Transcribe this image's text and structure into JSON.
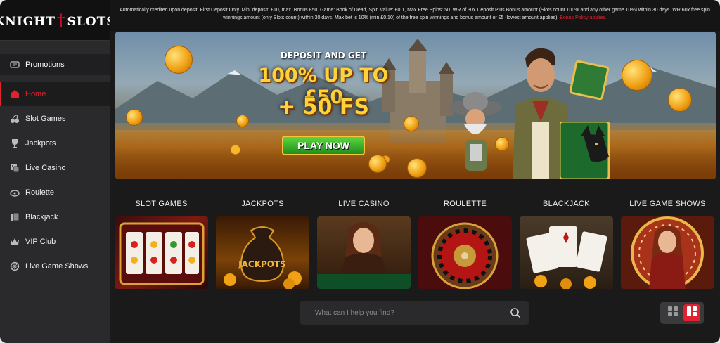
{
  "logo": {
    "left": "KNIGHT",
    "right": "SLOTS"
  },
  "notice": {
    "text": "Automatically credited upon deposit. First Deposit Only. Min. deposit: £10, max. Bonus £50. Game: Book of Dead, Spin Value: £0.1, Max Free Spins: 50. WR of 30x Deposit Plus Bonus amount (Slots count 100% and any other game 10%) within 30 days. WR 60x free spin winnings amount (only Slots count) within 30 days. Max bet is 10% (min £0.10) of the free spin winnings and bonus amount or £5 (lowest amount applies).",
    "policy_link": "Bonus Policy applies."
  },
  "sidebar": {
    "promo": {
      "label": "Promotions",
      "icon": "ticket-icon"
    },
    "items": [
      {
        "label": "Home",
        "icon": "home-icon",
        "active": true
      },
      {
        "label": "Slot Games",
        "icon": "cherries-icon"
      },
      {
        "label": "Jackpots",
        "icon": "trophy-icon"
      },
      {
        "label": "Live Casino",
        "icon": "dice-icon"
      },
      {
        "label": "Roulette",
        "icon": "roulette-icon"
      },
      {
        "label": "Blackjack",
        "icon": "cards-icon"
      },
      {
        "label": "VIP Club",
        "icon": "crown-icon"
      },
      {
        "label": "Live Game Shows",
        "icon": "wheel-icon"
      }
    ]
  },
  "banner": {
    "line1": "DEPOSIT AND GET",
    "line2": "100% UP TO £50",
    "line3": "+ 50 FS",
    "cta": "PLAY NOW"
  },
  "categories": [
    {
      "label": "SLOT GAMES"
    },
    {
      "label": "JACKPOTS",
      "image_text": "JACKPOTS"
    },
    {
      "label": "LIVE CASINO"
    },
    {
      "label": "ROULETTE"
    },
    {
      "label": "BLACKJACK"
    },
    {
      "label": "LIVE GAME SHOWS"
    }
  ],
  "search": {
    "placeholder": "What can I help you find?"
  },
  "colors": {
    "accent": "#e0212f",
    "sidebar": "#2a2a2c",
    "background": "#1a1a1a",
    "gold": "#ffd23a"
  }
}
